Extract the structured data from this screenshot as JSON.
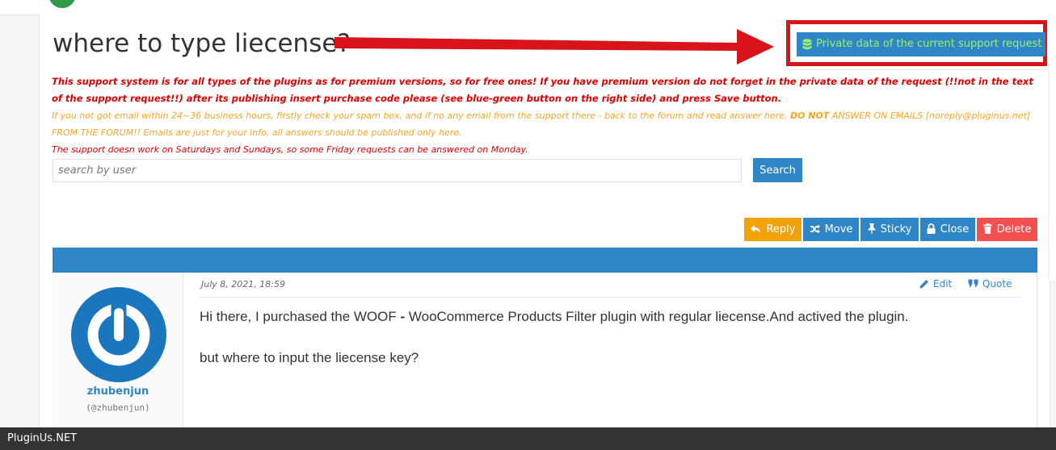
{
  "header": {
    "logo_tagline": "",
    "page_title": "where to type liecense?",
    "private_data_button": "Private data of the current support request"
  },
  "notices": {
    "main": "This support system is for all types of the plugins as for premium versions, so for free ones! If you have premium version do not forget in the private data of the request (!!not in the text of the support request!!) after its publishing insert purchase code please (see blue-green button on the right side) and press Save button.",
    "email_part1": "If you not got email within 24~36 business hours, firstly check your spam box, and if no any email from the support there - back to the forum and read answer here. ",
    "email_strong": "DO NOT",
    "email_part2": " ANSWER ON EMAILS [noreply@pluginus.net] FROM THE FORUM!! Emails are just for your info, all answers should be published only here.",
    "weekend": "The support doesn work on Saturdays and Sundays, so some Friday requests can be answered on Monday."
  },
  "search": {
    "placeholder": "search by user",
    "button": "Search"
  },
  "actions": {
    "reply": "Reply",
    "move": "Move",
    "sticky": "Sticky",
    "close": "Close",
    "delete": "Delete"
  },
  "post": {
    "date": "July 8, 2021, 18:59",
    "edit": "Edit",
    "quote": "Quote",
    "author_name": "zhubenjun",
    "author_handle": "(@zhubenjun)",
    "paragraph1_a": "Hi there, I purchased the WOOF ",
    "paragraph1_dash": "-",
    "paragraph1_b": " WooCommerce Products Filter plugin with regular liecense.And actived the plugin.",
    "paragraph2": "but where to input the liecense key?"
  },
  "footer": {
    "brand": "PluginUs.NET"
  },
  "colors": {
    "primary": "#2f86c7",
    "reply": "#f0a30a",
    "delete": "#f25050",
    "highlight": "#d8141a",
    "notice_red": "#e00000",
    "notice_orange": "#f5a623",
    "private_text": "#9ef06b"
  },
  "icons": [
    "database-icon",
    "reply-icon",
    "shuffle-icon",
    "pin-icon",
    "lock-icon",
    "trash-icon",
    "pencil-icon",
    "quote-icon",
    "avatar-power-icon"
  ]
}
